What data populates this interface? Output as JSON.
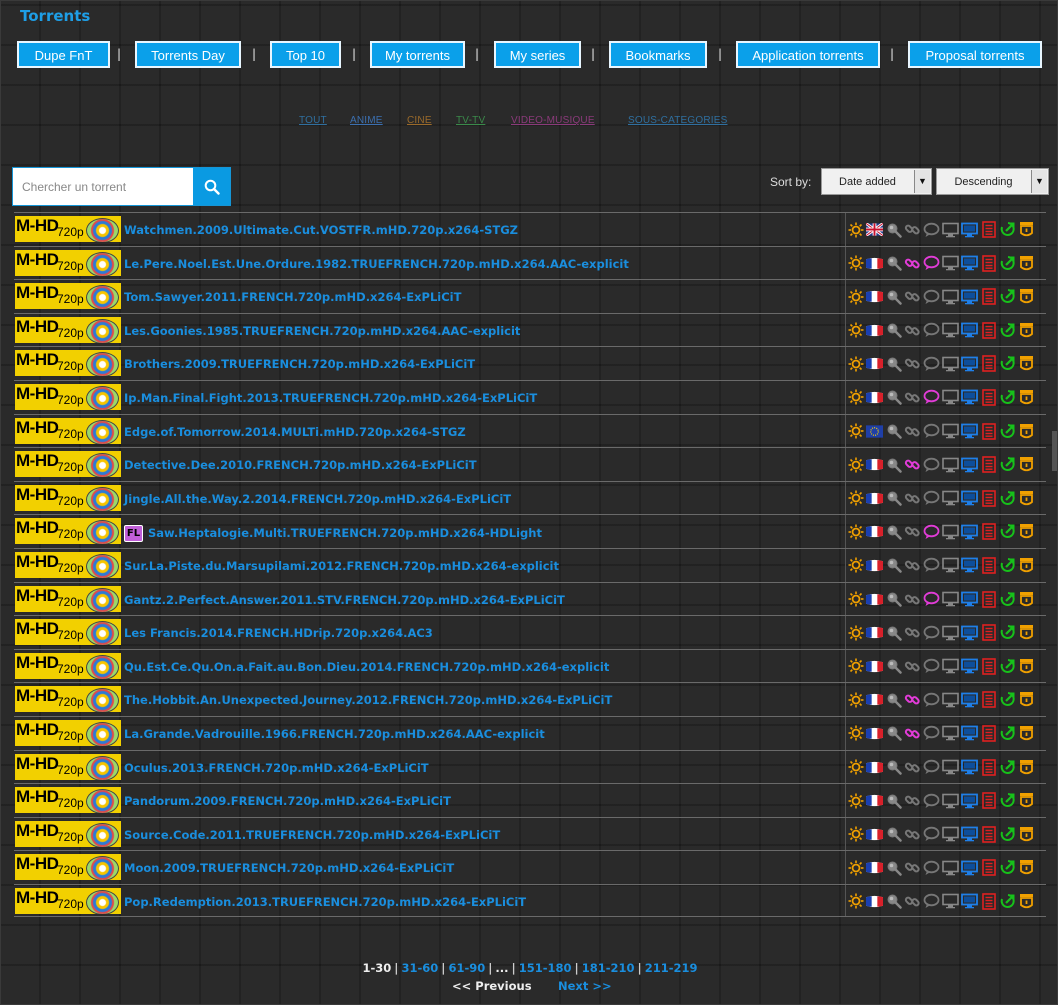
{
  "page": {
    "title": "Torrents"
  },
  "nav": [
    {
      "label": "Dupe FnT"
    },
    {
      "label": "Torrents Day"
    },
    {
      "label": "Top 10"
    },
    {
      "label": "My torrents"
    },
    {
      "label": "My series"
    },
    {
      "label": "Bookmarks"
    },
    {
      "label": "Application torrents"
    },
    {
      "label": "Proposal torrents"
    }
  ],
  "nav_separator": "|",
  "categories": [
    {
      "label": "TOUT",
      "color": "#2f6f9f"
    },
    {
      "label": "ANIME",
      "color": "#3b6fb0"
    },
    {
      "label": "CINE",
      "color": "#9a6a2a"
    },
    {
      "label": "TV-TV",
      "color": "#3a8a4a"
    },
    {
      "label": "VIDEO-MUSIQUE",
      "color": "#8a3a7a"
    },
    {
      "label": "SOUS-CATEGORIES",
      "color": "#2f6f9f"
    }
  ],
  "search": {
    "placeholder": "Chercher un torrent"
  },
  "sort": {
    "label": "Sort by:",
    "field": "Date added",
    "order": "Descending"
  },
  "badge": {
    "brand": "M-HD",
    "resolution": "720p"
  },
  "torrents": [
    {
      "name": "Watchmen.2009.Ultimate.Cut.VOSTFR.mHD.720p.x264-STGZ",
      "flag": "uk",
      "link": "gray",
      "comment": "gray",
      "fl": false
    },
    {
      "name": "Le.Pere.Noel.Est.Une.Ordure.1982.TRUEFRENCH.720p.mHD.x264.AAC-explicit",
      "flag": "fr",
      "link": "pink",
      "comment": "pink",
      "fl": false
    },
    {
      "name": "Tom.Sawyer.2011.FRENCH.720p.mHD.x264-ExPLiCiT",
      "flag": "fr",
      "link": "gray",
      "comment": "gray",
      "fl": false
    },
    {
      "name": "Les.Goonies.1985.TRUEFRENCH.720p.mHD.x264.AAC-explicit",
      "flag": "fr",
      "link": "gray",
      "comment": "gray",
      "fl": false
    },
    {
      "name": "Brothers.2009.TRUEFRENCH.720p.mHD.x264-ExPLiCiT",
      "flag": "fr",
      "link": "gray",
      "comment": "gray",
      "fl": false
    },
    {
      "name": "Ip.Man.Final.Fight.2013.TRUEFRENCH.720p.mHD.x264-ExPLiCiT",
      "flag": "fr",
      "link": "gray",
      "comment": "pink",
      "fl": false
    },
    {
      "name": "Edge.of.Tomorrow.2014.MULTi.mHD.720p.x264-STGZ",
      "flag": "eu",
      "link": "gray",
      "comment": "gray",
      "fl": false
    },
    {
      "name": "Detective.Dee.2010.FRENCH.720p.mHD.x264-ExPLiCiT",
      "flag": "fr",
      "link": "pink",
      "comment": "gray",
      "fl": false
    },
    {
      "name": "Jingle.All.the.Way.2.2014.FRENCH.720p.mHD.x264-ExPLiCiT",
      "flag": "fr",
      "link": "gray",
      "comment": "gray",
      "fl": false
    },
    {
      "name": "Saw.Heptalogie.Multi.TRUEFRENCH.720p.mHD.x264-HDLight",
      "flag": "fr",
      "link": "gray",
      "comment": "pink",
      "fl": true
    },
    {
      "name": "Sur.La.Piste.du.Marsupilami.2012.FRENCH.720p.mHD.x264-explicit",
      "flag": "fr",
      "link": "gray",
      "comment": "gray",
      "fl": false
    },
    {
      "name": "Gantz.2.Perfect.Answer.2011.STV.FRENCH.720p.mHD.x264-ExPLiCiT",
      "flag": "fr",
      "link": "gray",
      "comment": "pink",
      "fl": false
    },
    {
      "name": "Les Francis.2014.FRENCH.HDrip.720p.x264.AC3",
      "flag": "fr",
      "link": "gray",
      "comment": "gray",
      "fl": false
    },
    {
      "name": "Qu.Est.Ce.Qu.On.a.Fait.au.Bon.Dieu.2014.FRENCH.720p.mHD.x264-explicit",
      "flag": "fr",
      "link": "gray",
      "comment": "gray",
      "fl": false
    },
    {
      "name": "The.Hobbit.An.Unexpected.Journey.2012.FRENCH.720p.mHD.x264-ExPLiCiT",
      "flag": "fr",
      "link": "pink",
      "comment": "gray",
      "fl": false
    },
    {
      "name": "La.Grande.Vadrouille.1966.FRENCH.720p.mHD.x264.AAC-explicit",
      "flag": "fr",
      "link": "pink",
      "comment": "gray",
      "fl": false
    },
    {
      "name": "Oculus.2013.FRENCH.720p.mHD.x264-ExPLiCiT",
      "flag": "fr",
      "link": "gray",
      "comment": "gray",
      "fl": false
    },
    {
      "name": "Pandorum.2009.FRENCH.720p.mHD.x264-ExPLiCiT",
      "flag": "fr",
      "link": "gray",
      "comment": "gray",
      "fl": false
    },
    {
      "name": "Source.Code.2011.TRUEFRENCH.720p.mHD.x264-ExPLiCiT",
      "flag": "fr",
      "link": "gray",
      "comment": "gray",
      "fl": false
    },
    {
      "name": "Moon.2009.TRUEFRENCH.720p.mHD.x264-ExPLiCiT",
      "flag": "fr",
      "link": "gray",
      "comment": "gray",
      "fl": false
    },
    {
      "name": "Pop.Redemption.2013.TRUEFRENCH.720p.mHD.x264-ExPLiCiT",
      "flag": "fr",
      "link": "gray",
      "comment": "gray",
      "fl": false
    }
  ],
  "fl_label": "FL",
  "pagination": {
    "current": "1-30",
    "pages": [
      "31-60",
      "61-90",
      "...",
      "151-180",
      "181-210",
      "211-219"
    ],
    "separator": "|",
    "prev": "<< Previous",
    "next": "Next >>"
  },
  "colors": {
    "accent": "#0aa0ea",
    "link": "#1a8ede",
    "badge": "#f2d000",
    "pink": "#e23cd8",
    "green": "#17c21a",
    "red": "#e02020",
    "blue": "#1f7fe8",
    "orange": "#f0a000"
  },
  "row_icons": [
    "sun-icon",
    "flag-icon",
    "magnifier-icon",
    "link-icon",
    "comment-icon",
    "monitor-icon",
    "screen-icon",
    "nfo-icon",
    "download-icon",
    "bookmark-icon"
  ]
}
